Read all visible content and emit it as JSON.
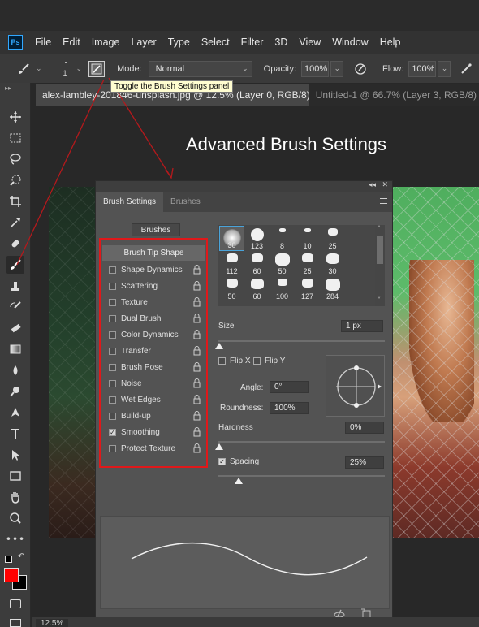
{
  "menubar": {
    "logo": "Ps",
    "items": [
      "File",
      "Edit",
      "Image",
      "Layer",
      "Type",
      "Select",
      "Filter",
      "3D",
      "View",
      "Window",
      "Help"
    ]
  },
  "options": {
    "brush_size": "1",
    "mode_label": "Mode:",
    "mode_value": "Normal",
    "opacity_label": "Opacity:",
    "opacity_value": "100%",
    "flow_label": "Flow:",
    "flow_value": "100%",
    "tooltip": "Toggle the Brush Settings panel"
  },
  "tabs": {
    "active": "alex-lambley-201846-unsplash.jpg @ 12.5% (Layer 0, RGB/8) *",
    "active_close": "×",
    "inactive": "Untitled-1 @ 66.7% (Layer 3, RGB/8)"
  },
  "annotation": {
    "headline": "Advanced Brush Settings",
    "colors": {
      "annotation_line": "#b4191c",
      "highlight_frame": "#e0181a"
    }
  },
  "panel": {
    "collapse": "◂◂",
    "close": "✕",
    "tab_active": "Brush Settings",
    "tab_inactive": "Brushes",
    "brushes_button": "Brushes",
    "tip_shape": "Brush Tip Shape",
    "settings": [
      {
        "label": "Shape Dynamics",
        "checked": false
      },
      {
        "label": "Scattering",
        "checked": false
      },
      {
        "label": "Texture",
        "checked": false
      },
      {
        "label": "Dual Brush",
        "checked": false
      },
      {
        "label": "Color Dynamics",
        "checked": false
      },
      {
        "label": "Transfer",
        "checked": false
      },
      {
        "label": "Brush Pose",
        "checked": false
      },
      {
        "label": "Noise",
        "checked": false
      },
      {
        "label": "Wet Edges",
        "checked": false
      },
      {
        "label": "Build-up",
        "checked": false
      },
      {
        "label": "Smoothing",
        "checked": true
      },
      {
        "label": "Protect Texture",
        "checked": false
      }
    ],
    "presets_row1": [
      "30",
      "123",
      "8",
      "10",
      "25"
    ],
    "presets_row2": [
      "112",
      "60",
      "50",
      "25",
      "30"
    ],
    "presets_row3": [
      "50",
      "60",
      "100",
      "127",
      "284"
    ],
    "size_label": "Size",
    "size_value": "1 px",
    "flip_x": "Flip X",
    "flip_y": "Flip Y",
    "angle_label": "Angle:",
    "angle_value": "0°",
    "roundness_label": "Roundness:",
    "roundness_value": "100%",
    "hardness_label": "Hardness",
    "hardness_value": "0%",
    "spacing_label": "Spacing",
    "spacing_value": "25%",
    "spacing_checked": true
  },
  "status": {
    "zoom": "12.5%"
  }
}
